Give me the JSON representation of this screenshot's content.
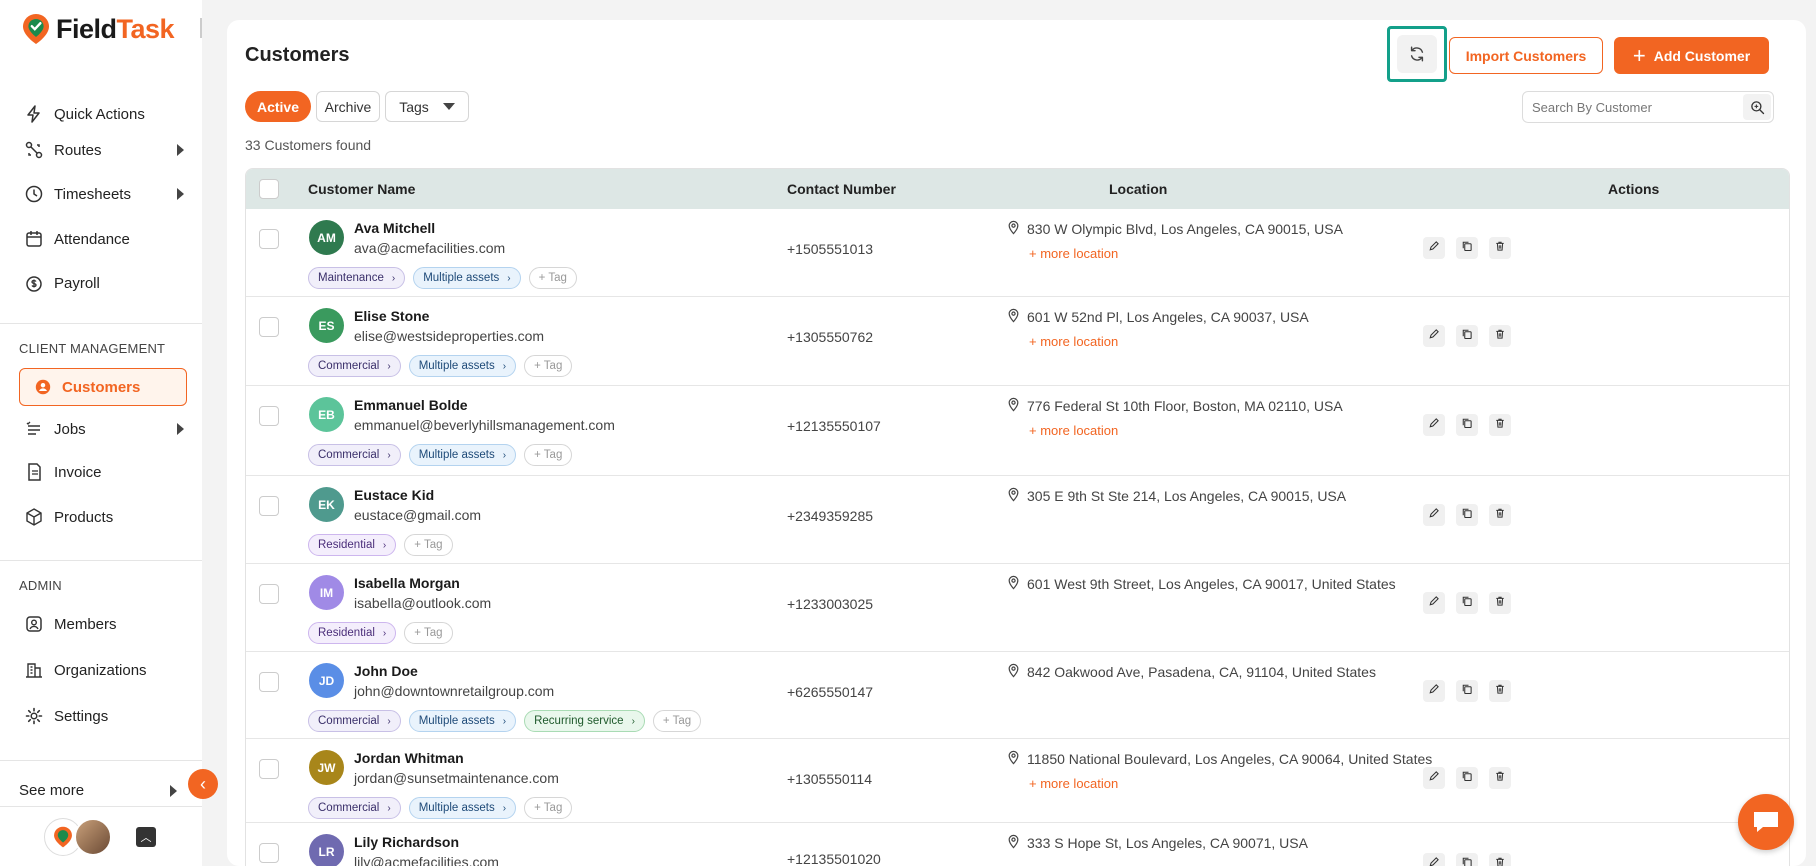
{
  "app": {
    "brand_field": "Field",
    "brand_task": "Task"
  },
  "sidebar": {
    "items": [
      {
        "label": "Quick Actions",
        "icon": "quick-actions-icon"
      },
      {
        "label": "Routes",
        "icon": "routes-icon"
      },
      {
        "label": "Timesheets",
        "icon": "clock-icon"
      },
      {
        "label": "Attendance",
        "icon": "calendar-icon"
      },
      {
        "label": "Payroll",
        "icon": "payroll-icon"
      }
    ],
    "client_section": "CLIENT MANAGEMENT",
    "client_items": [
      {
        "label": "Customers",
        "icon": "customers-icon"
      },
      {
        "label": "Jobs",
        "icon": "jobs-icon"
      },
      {
        "label": "Invoice",
        "icon": "invoice-icon"
      },
      {
        "label": "Products",
        "icon": "box-icon"
      }
    ],
    "admin_section": "ADMIN",
    "admin_items": [
      {
        "label": "Members",
        "icon": "members-icon"
      },
      {
        "label": "Organizations",
        "icon": "organizations-icon"
      },
      {
        "label": "Settings",
        "icon": "gear-icon"
      }
    ],
    "see_more": "See more"
  },
  "header": {
    "title": "Customers",
    "import_label": "Import Customers",
    "add_label": "Add Customer"
  },
  "filters": {
    "active": "Active",
    "archive": "Archive",
    "tags": "Tags",
    "search_placeholder": "Search By Customer",
    "count_text": "33 Customers found"
  },
  "table": {
    "columns": [
      "Customer Name",
      "Contact Number",
      "Location",
      "Actions"
    ],
    "add_tag_label": "+ Tag",
    "more_location_label": "+ more location",
    "rows": [
      {
        "initials": "AM",
        "color": "#2f7a4f",
        "name": "Ava Mitchell",
        "email": "ava@acmefacilities.com",
        "phone": "+1505551013",
        "location": "830 W Olympic Blvd, Los Angeles, CA 90015, USA",
        "more": true,
        "tags": [
          {
            "label": "Maintenance",
            "kind": "maint"
          },
          {
            "label": "Multiple assets",
            "kind": "assets"
          }
        ]
      },
      {
        "initials": "ES",
        "color": "#3a9a5e",
        "name": "Elise Stone",
        "email": "elise@westsideproperties.com",
        "phone": "+1305550762",
        "location": "601 W 52nd Pl, Los Angeles, CA 90037, USA",
        "more": true,
        "tags": [
          {
            "label": "Commercial",
            "kind": "commercial"
          },
          {
            "label": "Multiple assets",
            "kind": "assets"
          }
        ]
      },
      {
        "initials": "EB",
        "color": "#5cc49a",
        "name": "Emmanuel Bolde",
        "email": "emmanuel@beverlyhillsmanagement.com",
        "phone": "+12135550107",
        "location": "776 Federal St 10th Floor, Boston, MA 02110, USA",
        "more": true,
        "tags": [
          {
            "label": "Commercial",
            "kind": "commercial"
          },
          {
            "label": "Multiple assets",
            "kind": "assets"
          }
        ]
      },
      {
        "initials": "EK",
        "color": "#4f9a8e",
        "name": "Eustace Kid",
        "email": "eustace@gmail.com",
        "phone": "+2349359285",
        "location": "305 E 9th St Ste 214, Los Angeles, CA 90015, USA",
        "more": false,
        "tags": [
          {
            "label": "Residential",
            "kind": "resid"
          }
        ]
      },
      {
        "initials": "IM",
        "color": "#a08ae6",
        "name": "Isabella Morgan",
        "email": "isabella@outlook.com",
        "phone": "+1233003025",
        "location": "601 West 9th Street, Los Angeles, CA 90017, United States",
        "more": false,
        "tags": [
          {
            "label": "Residential",
            "kind": "resid"
          }
        ]
      },
      {
        "initials": "JD",
        "color": "#5a8ee6",
        "name": "John Doe",
        "email": "john@downtownretailgroup.com",
        "phone": "+6265550147",
        "location": "842 Oakwood Ave, Pasadena, CA, 91104, United States",
        "more": false,
        "tags": [
          {
            "label": "Commercial",
            "kind": "commercial"
          },
          {
            "label": "Multiple assets",
            "kind": "assets"
          },
          {
            "label": "Recurring service",
            "kind": "recur"
          }
        ]
      },
      {
        "initials": "JW",
        "color": "#a8861a",
        "name": "Jordan Whitman",
        "email": "jordan@sunsetmaintenance.com",
        "phone": "+1305550114",
        "location": "11850 National Boulevard, Los Angeles, CA 90064, United States",
        "more": true,
        "tags": [
          {
            "label": "Commercial",
            "kind": "commercial"
          },
          {
            "label": "Multiple assets",
            "kind": "assets"
          }
        ]
      },
      {
        "initials": "LR",
        "color": "#6f6ab0",
        "name": "Lily Richardson",
        "email": "lily@acmefacilities.com",
        "phone": "+12135501020",
        "location": "333 S Hope St, Los Angeles, CA 90071, USA",
        "more": false,
        "tags": []
      }
    ]
  }
}
